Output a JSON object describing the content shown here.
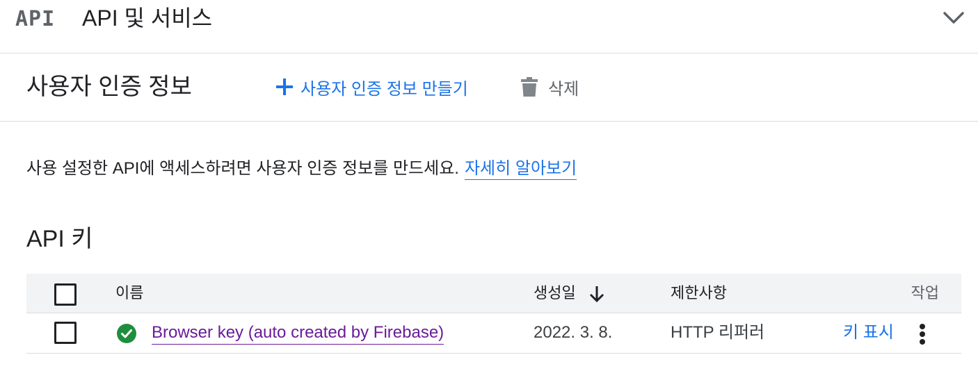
{
  "header": {
    "logo_text": "API",
    "title": "API 및 서비스",
    "icons": {
      "logo": "api-logo-icon",
      "expand": "chevron-down-icon"
    }
  },
  "toolbar": {
    "page_title": "사용자 인증 정보",
    "create_label": "사용자 인증 정보 만들기",
    "delete_label": "삭제",
    "icons": {
      "create": "plus-icon",
      "delete": "trash-icon"
    }
  },
  "info": {
    "text": "사용 설정한 API에 액세스하려면 사용자 인증 정보를 만드세요.",
    "link_label": "자세히 알아보기"
  },
  "api_keys": {
    "section_title": "API 키",
    "columns": {
      "name": "이름",
      "created": "생성일",
      "restrictions": "제한사항",
      "actions": "작업"
    },
    "sort": {
      "column": "created",
      "direction": "descending",
      "icon": "arrow-down-icon"
    },
    "rows": [
      {
        "name": "Browser key (auto created by Firebase)",
        "created": "2022. 3. 8.",
        "restriction": "HTTP 리퍼러",
        "show_key_label": "키 표시",
        "status_icon": "check-circle-icon",
        "menu_icon": "more-vert-icon"
      }
    ]
  },
  "colors": {
    "accent": "#1a73e8",
    "visited_link": "#6a1b9a",
    "success": "#1e8e3e",
    "header_bg": "#f1f3f4",
    "divider": "#dadce0",
    "icon_gray": "#5f6368"
  }
}
